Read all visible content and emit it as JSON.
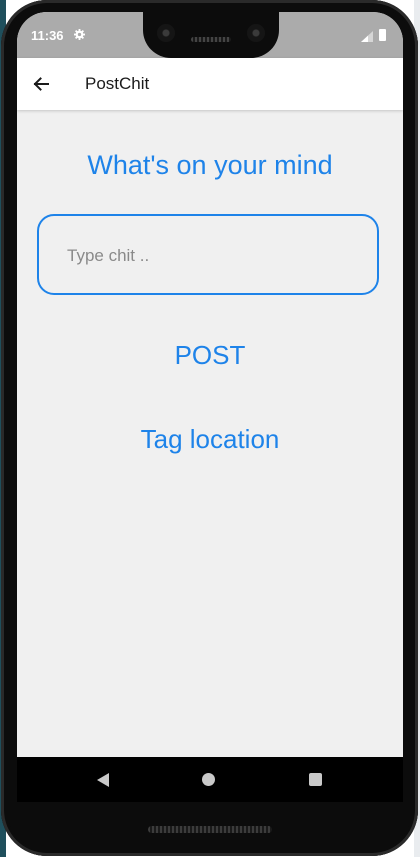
{
  "status_bar": {
    "time": "11:36",
    "icons": [
      "gear-icon",
      "signal-icon",
      "battery-icon"
    ]
  },
  "app_bar": {
    "title": "PostChit",
    "back_icon": "arrow-left-icon"
  },
  "main": {
    "heading": "What's on your mind",
    "chit_input": {
      "placeholder": "Type chit ..",
      "value": ""
    },
    "post_label": "POST",
    "tag_location_label": "Tag location"
  },
  "nav_bar": {
    "icons": [
      "nav-back-icon",
      "nav-home-icon",
      "nav-recents-icon"
    ]
  },
  "colors": {
    "accent": "#1e83e9",
    "background": "#f0f0f0",
    "status_bar": "#ababab",
    "app_bar": "#ffffff"
  }
}
